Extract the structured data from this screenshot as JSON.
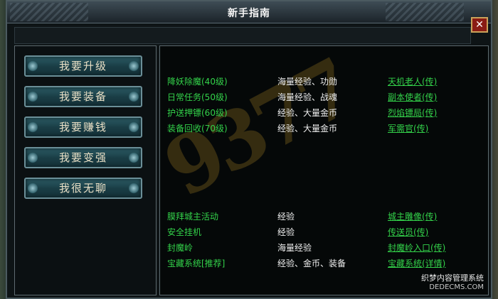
{
  "window": {
    "title": "新手指南",
    "close_label": "✕"
  },
  "nav": [
    {
      "label": "我要升级"
    },
    {
      "label": "我要装备"
    },
    {
      "label": "我要赚钱"
    },
    {
      "label": "我要变强"
    },
    {
      "label": "我很无聊"
    }
  ],
  "watermark": "9377",
  "section1": [
    {
      "name": "降妖除魔(40级)",
      "reward": "海量经验、功勋",
      "link": "天机老人(传)"
    },
    {
      "name": "日常任务(50级)",
      "reward": "海量经验、战魂",
      "link": "副本使者(传)"
    },
    {
      "name": "护送押镖(60级)",
      "reward": "经验、大量金币",
      "link": "烈焰镖局(传)"
    },
    {
      "name": "装备回收(70级)",
      "reward": "经验、大量金币",
      "link": "军需官(传)"
    }
  ],
  "section2": [
    {
      "name": "膜拜城主活动",
      "reward": "经验",
      "link": "城主雕像(传)"
    },
    {
      "name": "安全挂机",
      "reward": "经验",
      "link": "传送员(传)"
    },
    {
      "name": "封魔岭",
      "reward": "海量经验",
      "link": "封魔岭入口(传)"
    },
    {
      "name": "宝藏系统[推荐]",
      "reward": "经验、金币、装备",
      "link": "宝藏系统(详情)"
    }
  ],
  "footer": {
    "line1": "织梦内容管理系统",
    "line2": "DEDECMS.COM"
  },
  "colors": {
    "accent_green": "#33d24a",
    "close_red": "#8a1c14"
  }
}
